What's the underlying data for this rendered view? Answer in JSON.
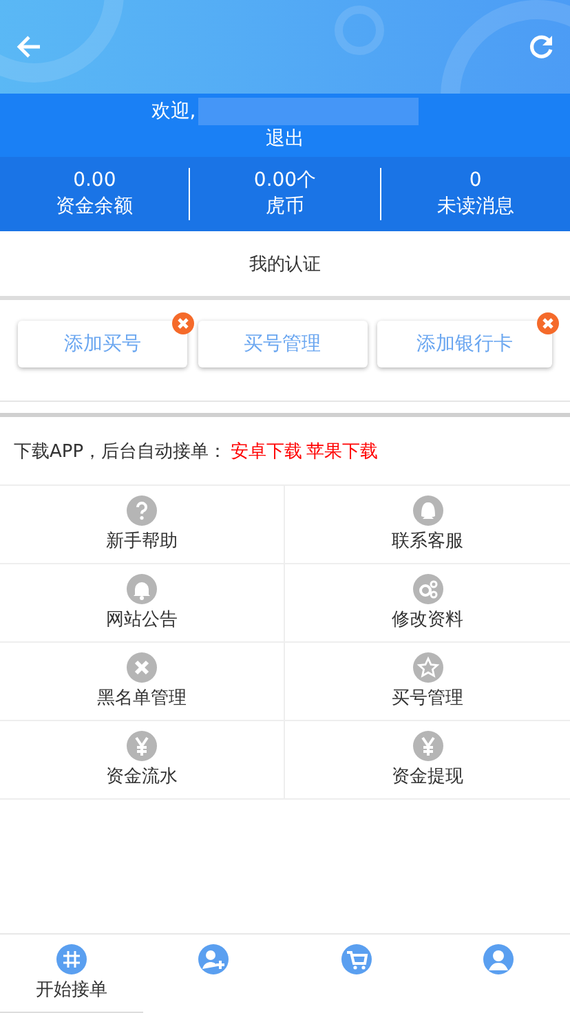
{
  "header": {
    "welcome": "欢迎,",
    "logout": "退出"
  },
  "stats": [
    {
      "value": "0.00",
      "label": "资金余额"
    },
    {
      "value": "0.00个",
      "label": "虎币"
    },
    {
      "value": "0",
      "label": "未读消息"
    }
  ],
  "verify": {
    "title": "我的认证",
    "buttons": [
      {
        "label": "添加买号",
        "badge": true
      },
      {
        "label": "买号管理",
        "badge": false
      },
      {
        "label": "添加银行卡",
        "badge": true
      }
    ]
  },
  "download": {
    "text": "下载APP，后台自动接单：",
    "links": [
      "安卓下载",
      "苹果下载"
    ]
  },
  "menu": [
    {
      "kind": "help",
      "label": "新手帮助"
    },
    {
      "kind": "chat",
      "label": "联系客服"
    },
    {
      "kind": "bell",
      "label": "网站公告"
    },
    {
      "kind": "gears",
      "label": "修改资料"
    },
    {
      "kind": "cross",
      "label": "黑名单管理"
    },
    {
      "kind": "star",
      "label": "买号管理"
    },
    {
      "kind": "yen",
      "label": "资金流水"
    },
    {
      "kind": "yen",
      "label": "资金提现"
    }
  ],
  "tabbar": [
    {
      "kind": "grid",
      "label": "开始接单",
      "selected": true
    },
    {
      "kind": "user-add",
      "selected": false
    },
    {
      "kind": "cart",
      "selected": false
    },
    {
      "kind": "user",
      "selected": false
    }
  ]
}
